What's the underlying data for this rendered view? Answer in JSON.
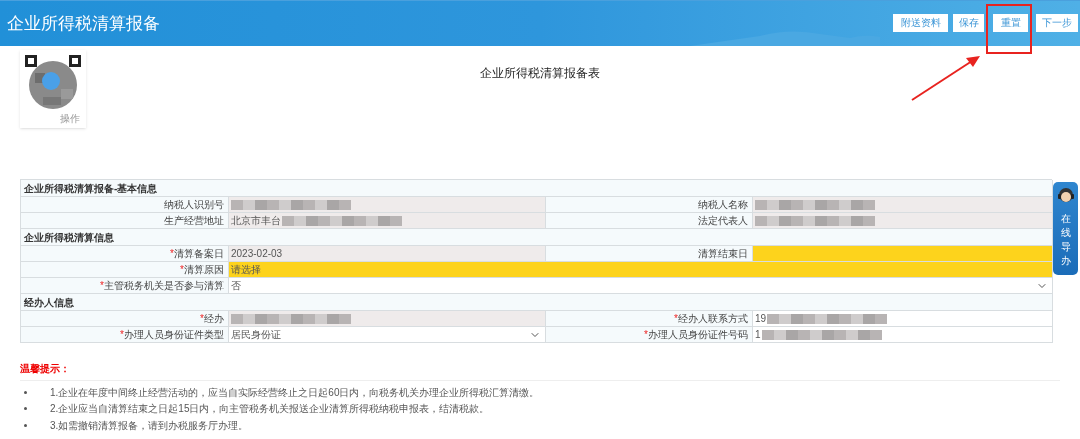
{
  "header": {
    "title": "企业所得税清算报备",
    "buttons": [
      "附送资料",
      "保存",
      "重置",
      "下一步"
    ]
  },
  "qr": {
    "caption": "操作"
  },
  "form_title": "企业所得税清算报备表",
  "sections": [
    {
      "title": "企业所得税清算报备-基本信息",
      "rows": [
        {
          "kind": "pair",
          "fields": [
            {
              "label": "纳税人识别号",
              "kind": "readonly",
              "blurred": true
            },
            {
              "label": "纳税人名称",
              "kind": "readonly",
              "blurred": true
            }
          ]
        },
        {
          "kind": "pair",
          "fields": [
            {
              "label": "生产经营地址",
              "value": "北京市丰台",
              "kind": "readonly",
              "blurred": true
            },
            {
              "label": "法定代表人",
              "kind": "readonly",
              "blurred": true
            }
          ]
        }
      ]
    },
    {
      "title": "企业所得税清算信息",
      "rows": [
        {
          "kind": "pair",
          "fields": [
            {
              "label": "清算备案日",
              "required_mark": "*",
              "value": "2023-02-03",
              "kind": "readonly",
              "blurred": false
            },
            {
              "label": "清算结束日",
              "kind": "required",
              "blurred": false
            }
          ]
        },
        {
          "kind": "wide",
          "fields": [
            {
              "label": "清算原因",
              "required_mark": "*",
              "value": "请选择",
              "kind": "required",
              "blurred": false
            }
          ]
        },
        {
          "kind": "wide",
          "fields": [
            {
              "label": "主管税务机关是否参与清算",
              "required_mark": "*",
              "value": "否",
              "kind": "select",
              "blurred": false
            }
          ]
        }
      ]
    },
    {
      "title": "经办人信息",
      "rows": [
        {
          "kind": "pair",
          "fields": [
            {
              "label": "经办",
              "required_mark": "*",
              "kind": "readonly",
              "blurred": true
            },
            {
              "label": "经办人联系方式",
              "required_mark": "*",
              "value": "19",
              "kind": "text",
              "blurred": true
            }
          ]
        },
        {
          "kind": "pair",
          "fields": [
            {
              "label": "办理人员身份证件类型",
              "required_mark": "*",
              "value": "居民身份证",
              "kind": "select",
              "blurred": false
            },
            {
              "label": "办理人员身份证件号码",
              "required_mark": "*",
              "value": "1",
              "kind": "text",
              "blurred": true
            }
          ]
        }
      ]
    }
  ],
  "guide": {
    "label": "在线导办"
  },
  "tips": {
    "title": "温馨提示：",
    "items": [
      "1.企业在年度中间终止经营活动的，应当自实际经营终止之日起60日内，向税务机关办理企业所得税汇算清缴。",
      "2.企业应当自清算结束之日起15日内，向主管税务机关报送企业清算所得税纳税申报表，结清税款。",
      "3.如需撤销清算报备，请到办税服务厅办理。"
    ]
  }
}
